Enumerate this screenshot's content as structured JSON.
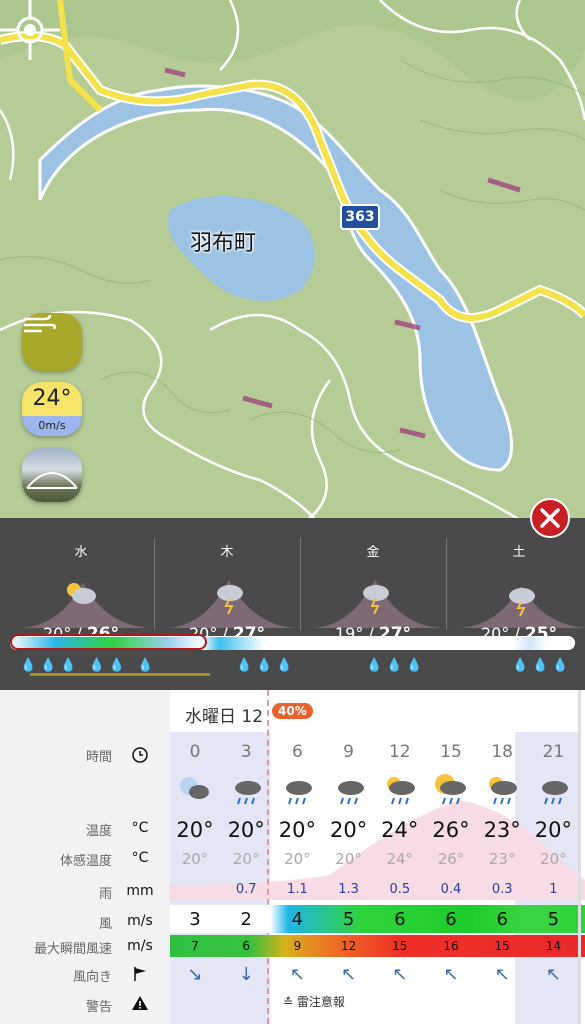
{
  "map": {
    "place_label": "羽布町",
    "route_number": "363"
  },
  "map_controls": {
    "temperature": "24°",
    "wind": "0m/s"
  },
  "forecast_days": [
    {
      "day": "水",
      "low": "20°",
      "high": "26°"
    },
    {
      "day": "木",
      "low": "20°",
      "high": "27°"
    },
    {
      "day": "金",
      "low": "19°",
      "high": "27°"
    },
    {
      "day": "土",
      "low": "20°",
      "high": "25°"
    }
  ],
  "hourly": {
    "date_label": "水曜日 12",
    "precip_badge": "40%",
    "row_labels": {
      "time": "時間",
      "temp": "温度",
      "feels": "体感温度",
      "rain": "雨",
      "wind": "風",
      "gust": "最大瞬間風速",
      "direction": "風向き",
      "warning": "警告"
    },
    "units": {
      "temp": "°C",
      "feels": "°C",
      "rain": "mm",
      "wind": "m/s",
      "gust": "m/s"
    },
    "hours": [
      "0",
      "3",
      "6",
      "9",
      "12",
      "15",
      "18",
      "21"
    ],
    "temps": [
      "20°",
      "20°",
      "20°",
      "20°",
      "24°",
      "26°",
      "23°",
      "20°"
    ],
    "feels": [
      "20°",
      "20°",
      "20°",
      "20°",
      "24°",
      "26°",
      "23°",
      "20°"
    ],
    "rain": [
      "",
      "0.7",
      "1.1",
      "1.3",
      "0.5",
      "0.4",
      "0.3",
      "1"
    ],
    "wind": [
      "3",
      "2",
      "4",
      "5",
      "6",
      "6",
      "6",
      "5"
    ],
    "gust": [
      "7",
      "6",
      "9",
      "12",
      "15",
      "16",
      "15",
      "14"
    ],
    "directions": [
      "↘",
      "↓",
      "↖",
      "↖",
      "↖",
      "↖",
      "↖",
      "↖"
    ],
    "warning_text": "雷注意報"
  },
  "colors": {
    "close": "#c91e24",
    "badge": "#e9622b",
    "road": "#f4e24a",
    "water": "#9cc3e3"
  }
}
